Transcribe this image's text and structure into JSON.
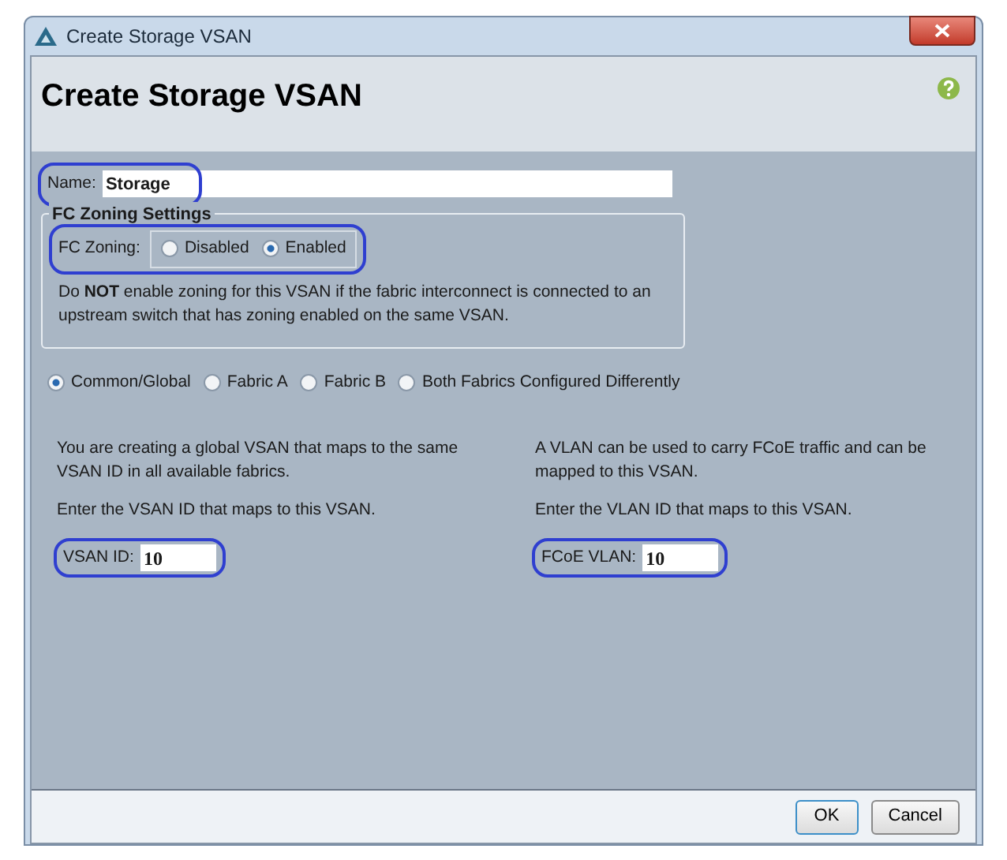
{
  "window": {
    "title": "Create Storage VSAN"
  },
  "header": {
    "title": "Create Storage VSAN"
  },
  "name_field": {
    "label": "Name:",
    "value": "Storage",
    "highlighted": true
  },
  "fc_zoning_settings": {
    "legend": "FC Zoning Settings",
    "label": "FC Zoning:",
    "highlighted": true,
    "options": [
      {
        "label": "Disabled",
        "selected": false
      },
      {
        "label": "Enabled",
        "selected": true
      }
    ],
    "note": "Do **NOT** enable zoning for this VSAN if the fabric interconnect is connected to an upstream switch that has zoning enabled on the same VSAN."
  },
  "fabric_options": [
    {
      "label": "Common/Global",
      "selected": true
    },
    {
      "label": "Fabric A",
      "selected": false
    },
    {
      "label": "Fabric B",
      "selected": false
    },
    {
      "label": "Both Fabrics Configured Differently",
      "selected": false
    }
  ],
  "columns": [
    {
      "description": "You are creating a global VSAN that maps to the same VSAN ID in all available fabrics.",
      "instruction": "Enter the VSAN ID that maps to this VSAN.",
      "label": "VSAN ID:",
      "value": "10",
      "highlighted": true
    },
    {
      "description": "A VLAN can be used to carry FCoE traffic and can be mapped to this VSAN.",
      "instruction": "Enter the VLAN ID that maps to this VSAN.",
      "label": "FCoE VLAN:",
      "value": "10",
      "highlighted": true
    }
  ],
  "buttons": [
    "OK",
    "Cancel"
  ]
}
